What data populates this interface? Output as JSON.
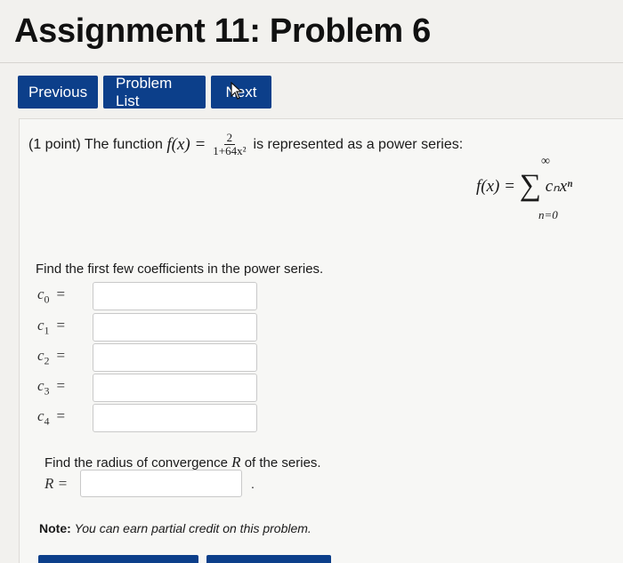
{
  "page": {
    "title": "Assignment 11: Problem 6"
  },
  "nav": {
    "previous": "Previous",
    "problem_list": "Problem List",
    "next": "Next"
  },
  "problem": {
    "points": "(1 point) The function",
    "function_lhs": "f(x) =",
    "fraction": {
      "numerator": "2",
      "denominator": "1+64x²"
    },
    "intro_tail": "is represented as a power series:",
    "series": {
      "lhs": "f(x) =",
      "sigma": "∑",
      "term": "cₙxⁿ",
      "upper": "∞",
      "lower": "n=0"
    },
    "coef_prompt": "Find the first few coefficients in the power series.",
    "coefficients": [
      {
        "label": "c",
        "sub": "0",
        "value": ""
      },
      {
        "label": "c",
        "sub": "1",
        "value": ""
      },
      {
        "label": "c",
        "sub": "2",
        "value": ""
      },
      {
        "label": "c",
        "sub": "3",
        "value": ""
      },
      {
        "label": "c",
        "sub": "4",
        "value": ""
      }
    ],
    "radius_prompt_a": "Find the radius of convergence",
    "radius_var": "R",
    "radius_prompt_b": "of the series.",
    "radius_label": "R =",
    "radius_value": "",
    "note_label": "Note:",
    "note_text": "You can earn partial credit on this problem."
  }
}
